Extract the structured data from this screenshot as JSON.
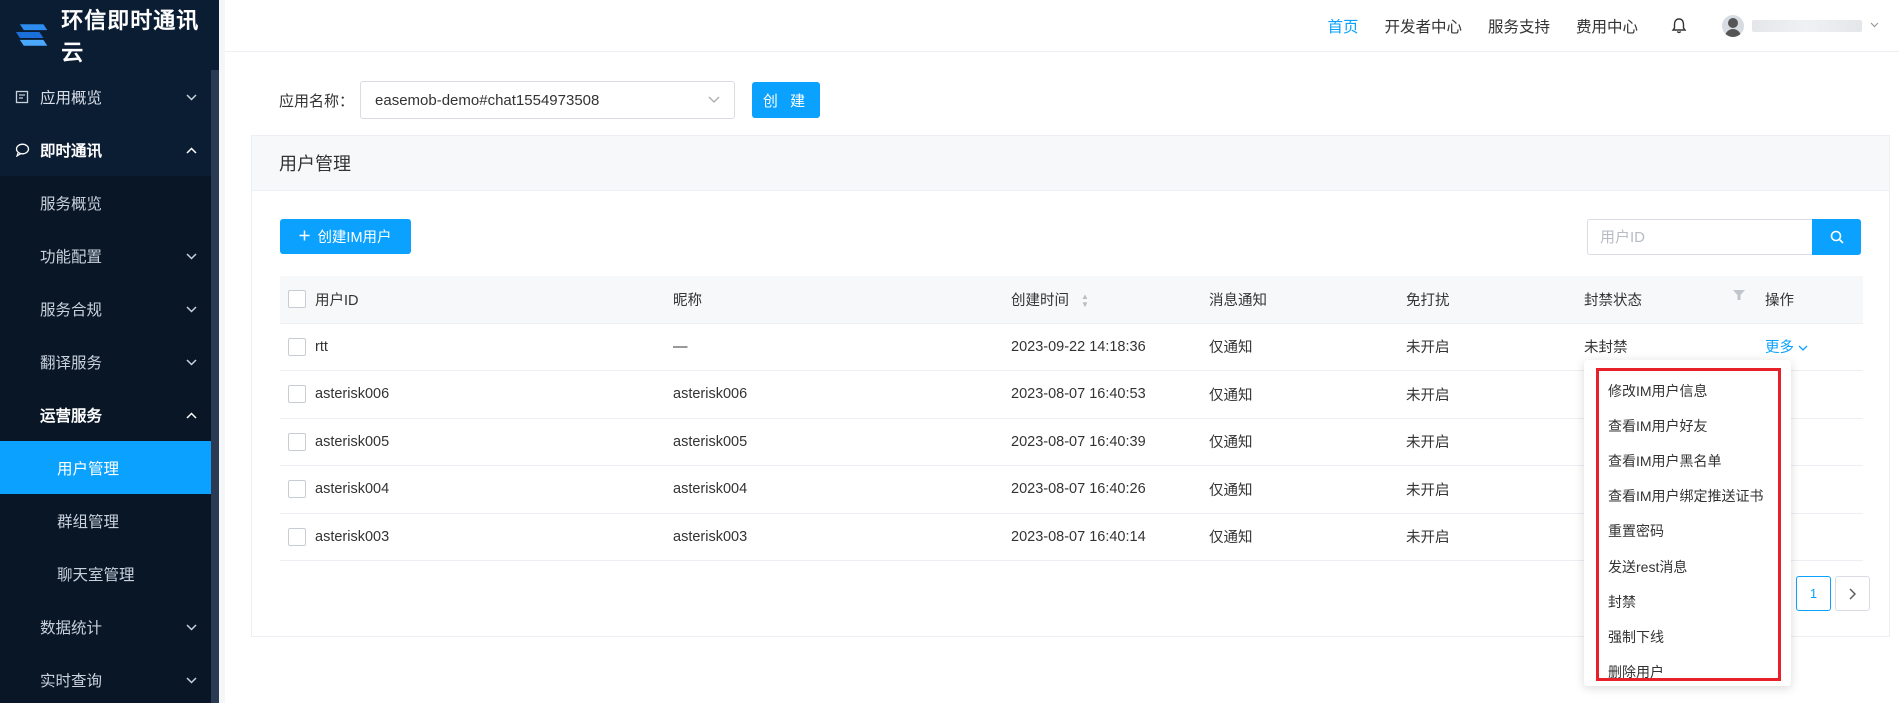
{
  "brand": {
    "name": "环信即时通讯云"
  },
  "topnav": {
    "items": [
      "首页",
      "开发者中心",
      "服务支持",
      "费用中心"
    ],
    "active_index": 0
  },
  "sidebar": {
    "items": [
      {
        "label": "应用概览",
        "icon": "document-icon",
        "expanded": false
      },
      {
        "label": "即时通讯",
        "icon": "chat-icon",
        "expanded": true
      },
      {
        "label": "服务概览"
      },
      {
        "label": "功能配置",
        "expanded": false
      },
      {
        "label": "服务合规",
        "expanded": false
      },
      {
        "label": "翻译服务",
        "expanded": false
      },
      {
        "label": "运营服务",
        "expanded": true
      },
      {
        "label": "用户管理",
        "active": true
      },
      {
        "label": "群组管理"
      },
      {
        "label": "聊天室管理"
      },
      {
        "label": "数据统计",
        "expanded": false
      },
      {
        "label": "实时查询",
        "expanded": false
      }
    ]
  },
  "app_select": {
    "label": "应用名称：",
    "value": "easemob-demo#chat1554973508",
    "create_label": "创 建"
  },
  "panel": {
    "title": "用户管理",
    "create_user_label": "创建IM用户",
    "search_placeholder": "用户ID"
  },
  "table": {
    "headers": [
      "用户ID",
      "昵称",
      "创建时间",
      "消息通知",
      "免打扰",
      "封禁状态",
      "操作"
    ],
    "rows": [
      {
        "id": "rtt",
        "nick": "—",
        "time": "2023-09-22 14:18:36",
        "notify": "仅通知",
        "dnd": "未开启",
        "ban": "未封禁",
        "action": "更多"
      },
      {
        "id": "asterisk006",
        "nick": "asterisk006",
        "time": "2023-08-07 16:40:53",
        "notify": "仅通知",
        "dnd": "未开启",
        "ban": "",
        "action": ""
      },
      {
        "id": "asterisk005",
        "nick": "asterisk005",
        "time": "2023-08-07 16:40:39",
        "notify": "仅通知",
        "dnd": "未开启",
        "ban": "",
        "action": ""
      },
      {
        "id": "asterisk004",
        "nick": "asterisk004",
        "time": "2023-08-07 16:40:26",
        "notify": "仅通知",
        "dnd": "未开启",
        "ban": "",
        "action": ""
      },
      {
        "id": "asterisk003",
        "nick": "asterisk003",
        "time": "2023-08-07 16:40:14",
        "notify": "仅通知",
        "dnd": "未开启",
        "ban": "",
        "action": ""
      }
    ]
  },
  "pagination": {
    "current": "1"
  },
  "dropdown": {
    "items": [
      "修改IM用户信息",
      "查看IM用户好友",
      "查看IM用户黑名单",
      "查看IM用户绑定推送证书",
      "重置密码",
      "发送rest消息",
      "封禁",
      "强制下线",
      "删除用户"
    ],
    "highlight_color": "#e8202a"
  },
  "colors": {
    "accent": "#0aa1ff",
    "sidebar_bg": "#0b1d33"
  }
}
